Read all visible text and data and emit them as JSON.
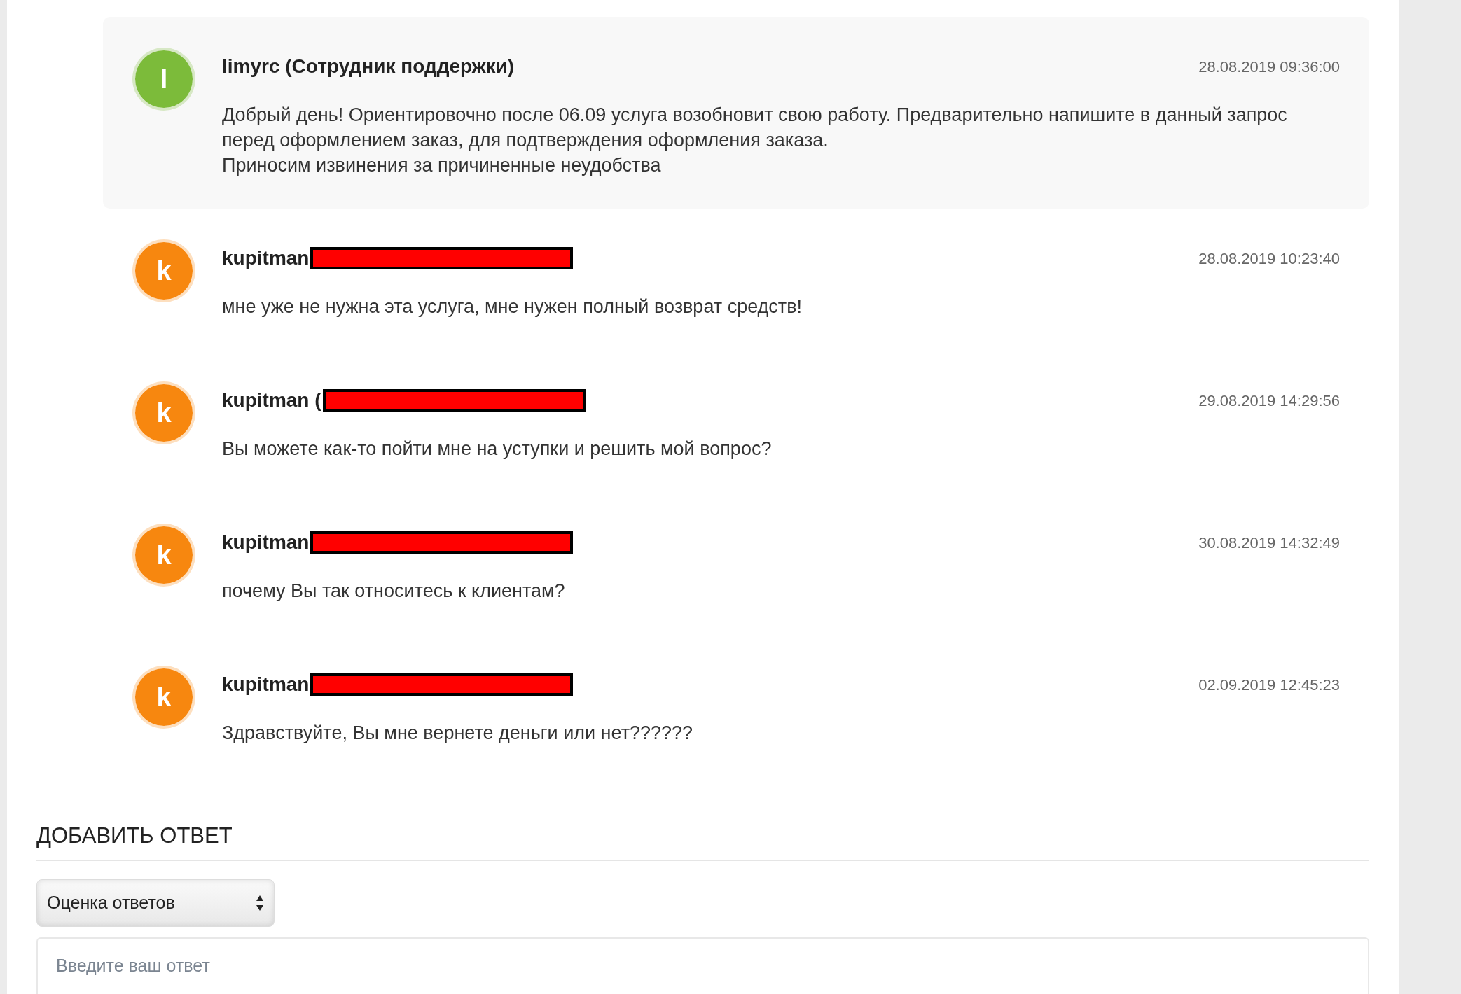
{
  "messages": [
    {
      "avatar_letter": "l",
      "color": "#7cbb3a",
      "author": "limyrc (Сотрудник поддержки)",
      "redacted": false,
      "highlighted": true,
      "date": "28.08.2019 09:36:00",
      "text": "Добрый день! Ориентировочно после 06.09 услуга возобновит свою работу. Предварительно напишите в данный запрос перед оформлением заказ, для подтверждения оформления заказа.\nПриносим извинения за причиненные неудобства"
    },
    {
      "avatar_letter": "k",
      "color": "#f7870f",
      "author": "kupitman",
      "redacted": true,
      "highlighted": false,
      "date": "28.08.2019 10:23:40",
      "text": "мне уже не нужна эта услуга, мне нужен полный возврат средств!"
    },
    {
      "avatar_letter": "k",
      "color": "#f7870f",
      "author": "kupitman (",
      "redacted": true,
      "highlighted": false,
      "date": "29.08.2019 14:29:56",
      "text": "Вы можете как-то пойти мне на уступки и решить мой вопрос?"
    },
    {
      "avatar_letter": "k",
      "color": "#f7870f",
      "author": "kupitman",
      "redacted": true,
      "highlighted": false,
      "date": "30.08.2019 14:32:49",
      "text": "почему Вы так относитесь к клиентам?"
    },
    {
      "avatar_letter": "k",
      "color": "#f7870f",
      "author": "kupitman",
      "redacted": true,
      "highlighted": false,
      "date": "02.09.2019 12:45:23",
      "text": "Здравствуйте, Вы мне вернете деньги или нет??????"
    }
  ],
  "reply": {
    "heading": "ДОБАВИТЬ ОТВЕТ",
    "rating_select": "Оценка ответов",
    "answer_field": {
      "placeholder": "Введите ваш ответ"
    }
  }
}
